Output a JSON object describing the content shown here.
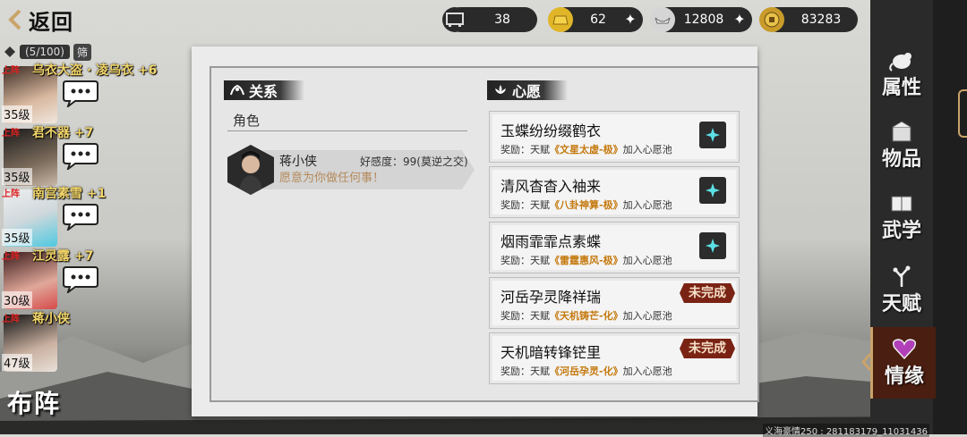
{
  "back_label": "返回",
  "resources": [
    {
      "icon": "frame-icon",
      "value": "38",
      "has_plus": false
    },
    {
      "icon": "gold-bar-icon",
      "value": "62",
      "has_plus": true
    },
    {
      "icon": "silver-ingot-icon",
      "value": "12808",
      "has_plus": true
    },
    {
      "icon": "coin-icon",
      "value": "83283",
      "has_plus": false
    }
  ],
  "roster": {
    "count": "(5/100)",
    "filter_label": "筛",
    "members": [
      {
        "tag": "上阵",
        "name": "乌衣大盗 · 凌乌衣",
        "plus": "+6",
        "level": "35级"
      },
      {
        "tag": "上阵",
        "name": "君不器",
        "plus": "+7",
        "level": "35级"
      },
      {
        "tag": "上阵",
        "name": "南宫素雪",
        "plus": "+1",
        "level": "35级"
      },
      {
        "tag": "上阵",
        "name": "江灵露",
        "plus": "+7",
        "level": "30级"
      },
      {
        "tag": "上阵",
        "name": "蒋小侠",
        "plus": "",
        "level": "47级"
      }
    ],
    "formation_label": "布阵"
  },
  "relations": {
    "title": "关系",
    "role_label": "角色",
    "npc": {
      "name": "蒋小侠",
      "favor": "好感度：99(莫逆之交)",
      "line": "愿意为你做任何事！"
    }
  },
  "wishes": {
    "title": "心愿",
    "reward_prefix": "奖励：天赋",
    "reward_suffix": "加入心愿池",
    "undone_label": "未完成",
    "items": [
      {
        "title": "玉蝶纷纷缀鹤衣",
        "talent": "《文星太虚-极》",
        "status": "claim"
      },
      {
        "title": "清风杳杳入袖来",
        "talent": "《八卦神算-极》",
        "status": "claim"
      },
      {
        "title": "烟雨霏霏点素蝶",
        "talent": "《雷霆惠风-极》",
        "status": "claim"
      },
      {
        "title": "河岳孕灵降祥瑞",
        "talent": "《天机铸芒-化》",
        "status": "undone"
      },
      {
        "title": "天机暗转锋铓里",
        "talent": "《河岳孕灵-化》",
        "status": "undone"
      }
    ]
  },
  "tabs": [
    {
      "label": "属性",
      "icon": "rat-icon",
      "active": false
    },
    {
      "label": "物品",
      "icon": "box-icon",
      "active": false
    },
    {
      "label": "武学",
      "icon": "book-icon",
      "active": false
    },
    {
      "label": "天赋",
      "icon": "branch-icon",
      "active": false
    },
    {
      "label": "情缘",
      "icon": "heart-icon",
      "active": true
    }
  ],
  "sysinfo": "义海豪情250 : 281183179_11031436",
  "colors": {
    "talent": "#c5790e",
    "undone_badge": "#7a2314",
    "active_tab": "#4a1e10",
    "name_gold": "#f2d56a"
  }
}
